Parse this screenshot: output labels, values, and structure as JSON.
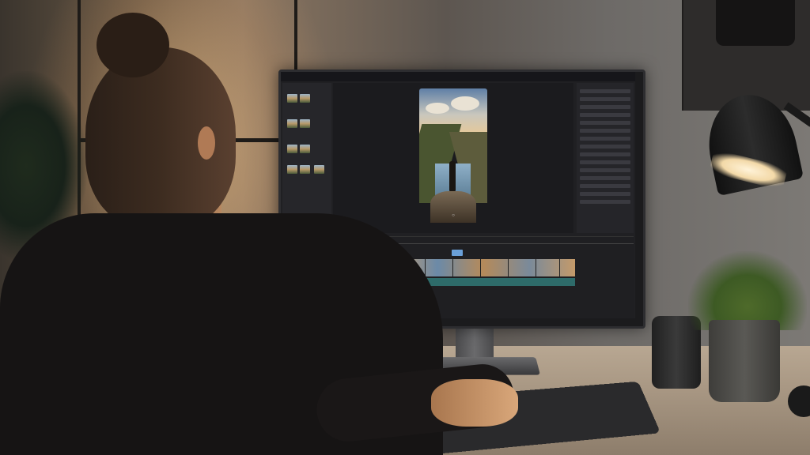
{
  "scene": {
    "description_tags": [
      "woman",
      "desk",
      "monitor",
      "video-editor",
      "lamp",
      "plant",
      "speaker"
    ]
  },
  "editor": {
    "menu_items": [
      "",
      "",
      "",
      "",
      "",
      ""
    ]
  },
  "colors": {
    "accent": "#6aa0d8",
    "audio_track": "#2e6b6a",
    "ui_bg": "#202023"
  }
}
